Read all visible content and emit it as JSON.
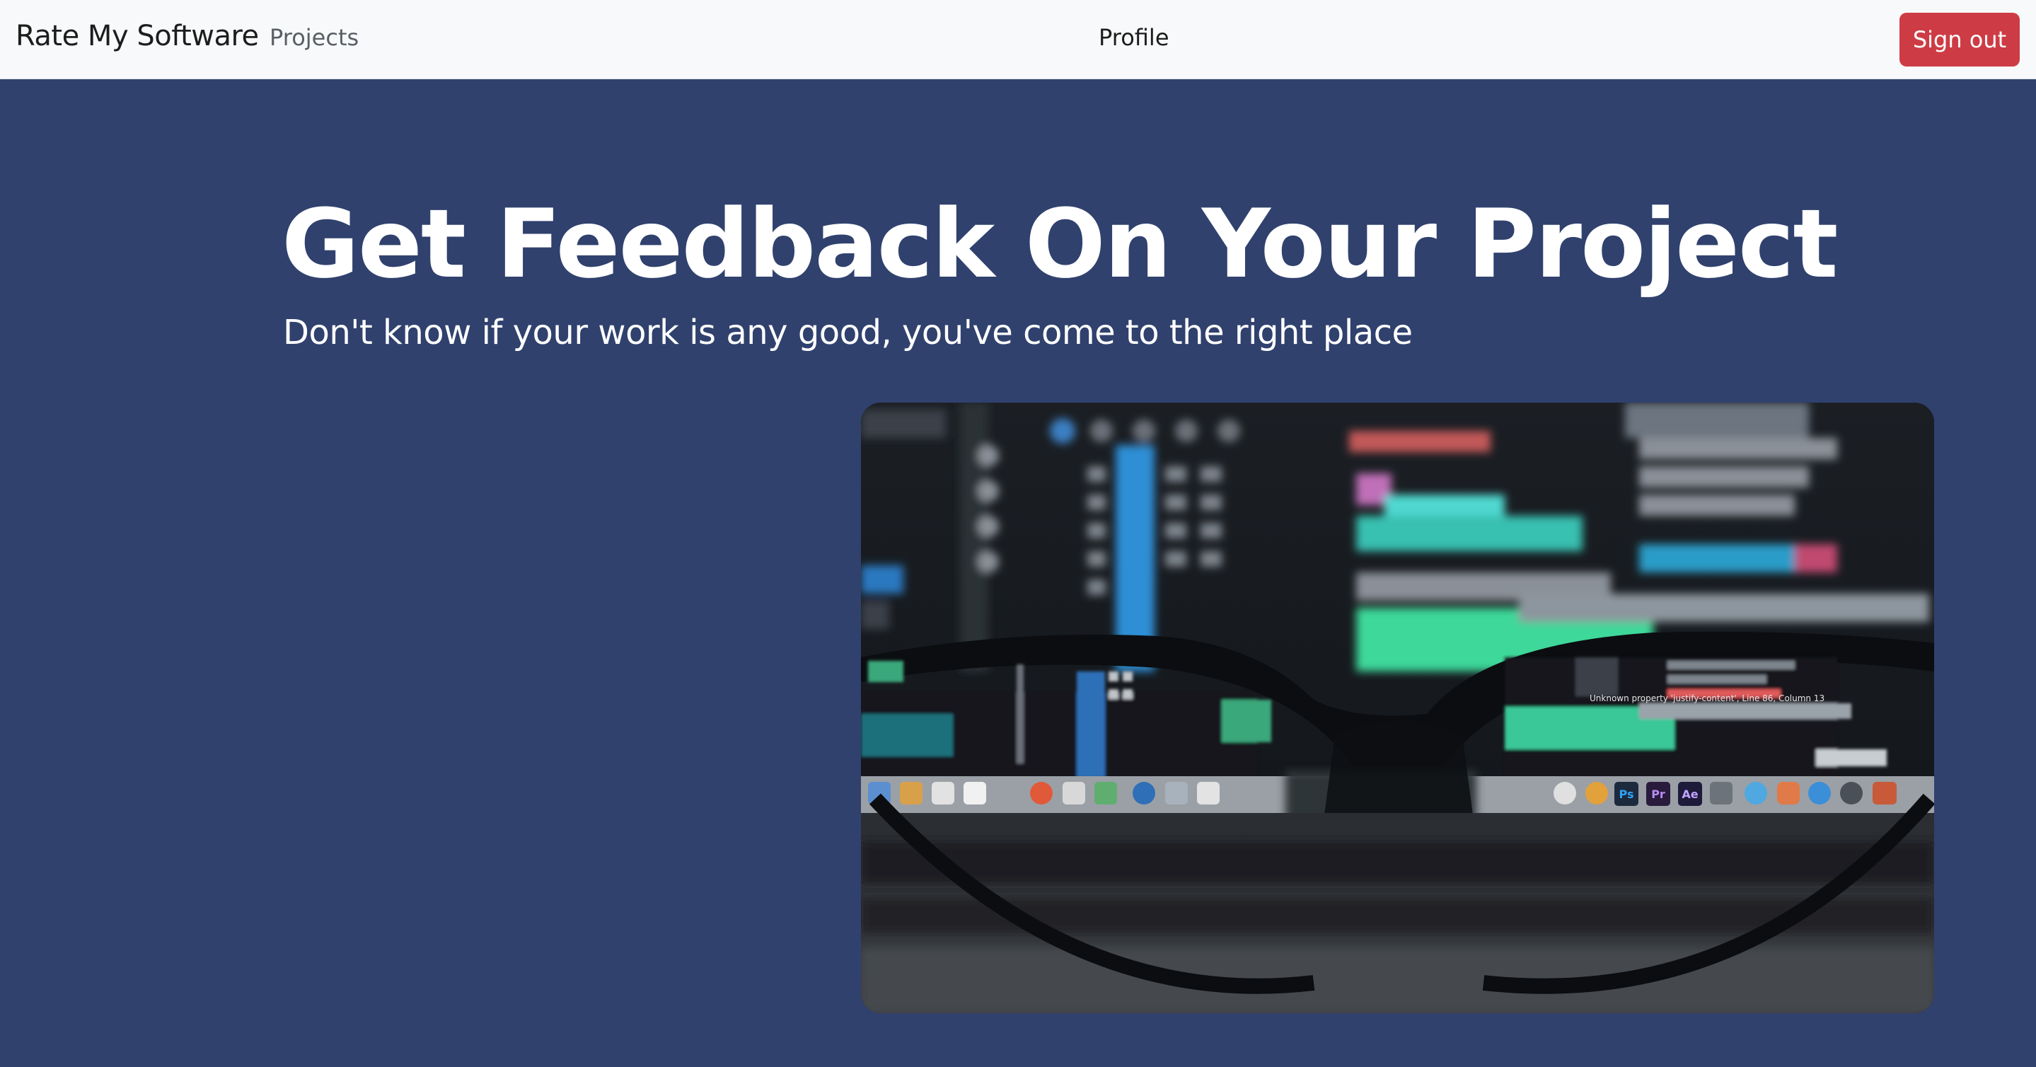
{
  "navbar": {
    "brand": "Rate My Software",
    "links": [
      {
        "label": "Projects"
      },
      {
        "label": "Profile"
      }
    ],
    "signout_label": "Sign out"
  },
  "hero": {
    "title": "Get Feedback On Your Project",
    "subtitle": "Don't know if your work is any good, you've come to the right place",
    "image_text": {
      "error_tooltip": "Unknown property 'justify-content', Line 86, Column 13",
      "dock_labels": [
        "Ps",
        "Pr",
        "Ae"
      ]
    }
  },
  "colors": {
    "hero_bg": "#30416e",
    "navbar_bg": "#f8f9fa",
    "signout_bg": "#cd3c45"
  }
}
